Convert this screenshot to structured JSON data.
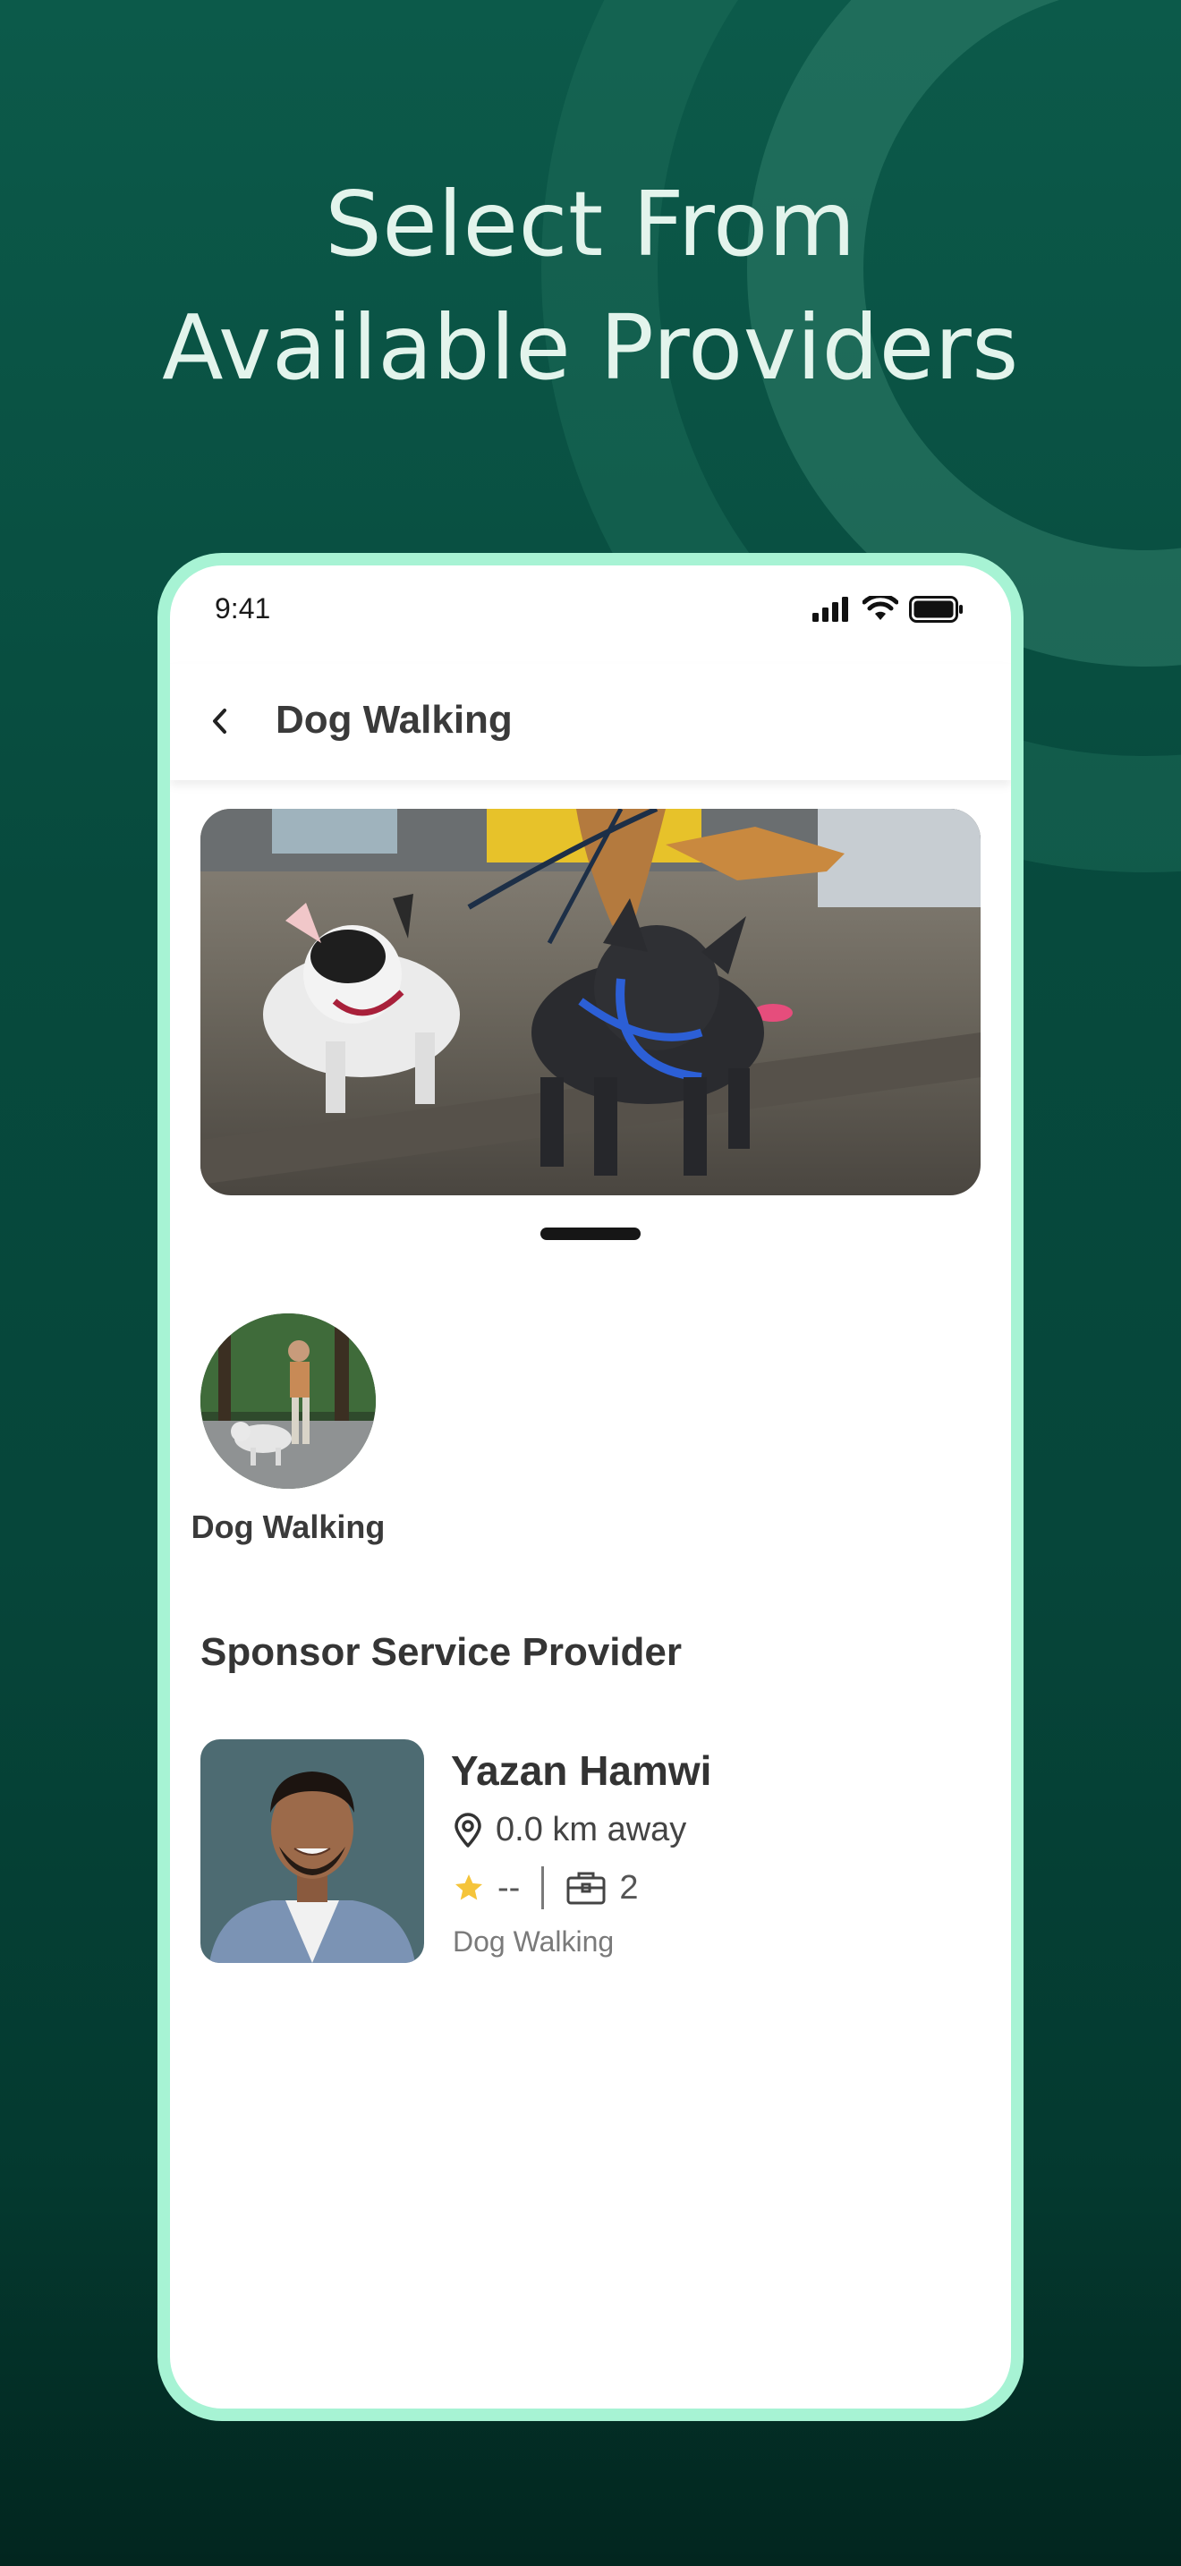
{
  "headline": {
    "line1": "Select From",
    "line2": "Available Providers"
  },
  "status_bar": {
    "time": "9:41"
  },
  "header": {
    "title": "Dog Walking"
  },
  "hero": {
    "pager_active": 1
  },
  "categories": [
    {
      "label": "Dog Walking"
    }
  ],
  "section": {
    "title": "Sponsor Service Provider"
  },
  "provider": {
    "name": "Yazan Hamwi",
    "distance": "0.0 km away",
    "rating": "--",
    "jobs": "2",
    "service": "Dog Walking"
  },
  "colors": {
    "background": "#074a3d",
    "phone_border": "#a7f3d4",
    "headline_text": "#e3f4ec",
    "star": "#f5c43a"
  },
  "icons": {
    "back": "chevron-left-icon",
    "signal": "signal-icon",
    "wifi": "wifi-icon",
    "battery": "battery-icon",
    "location": "location-pin-icon",
    "star": "star-icon",
    "briefcase": "briefcase-icon"
  }
}
